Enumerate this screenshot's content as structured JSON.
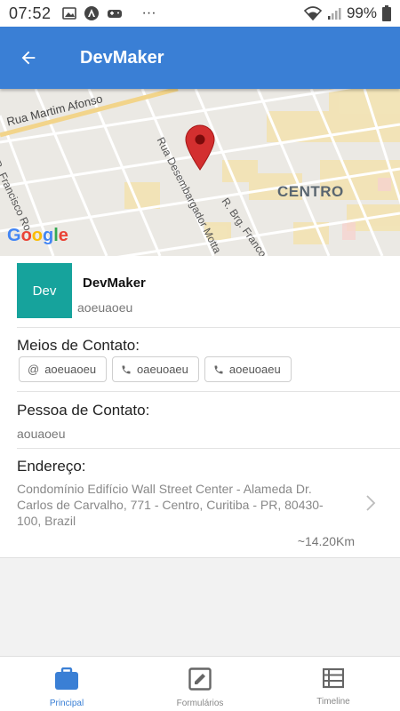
{
  "status_bar": {
    "time": "07:52",
    "battery": "99%",
    "more": "···"
  },
  "app_bar": {
    "title": "DevMaker"
  },
  "map": {
    "streets": [
      "Rua Martim Afonso",
      "R. Francisco Ro",
      "Rua Desembargador Motta",
      "R. Brg. Franco"
    ],
    "district": "CENTRO",
    "attribution": "Google"
  },
  "company": {
    "logo_text": "Dev",
    "name": "DevMaker",
    "subtitle": "aoeuaoeu"
  },
  "contact_means": {
    "title": "Meios de Contato:",
    "chips": [
      {
        "icon": "at-icon",
        "label": "aoeuaoeu"
      },
      {
        "icon": "phone-icon",
        "label": "oaeuoaeu"
      },
      {
        "icon": "phone-icon",
        "label": "aoeuoaeu"
      }
    ]
  },
  "contact_person": {
    "title": "Pessoa de Contato:",
    "value": "aouaoeu"
  },
  "address": {
    "title": "Endereço:",
    "value": "Condomínio Edifício Wall Street Center - Alameda Dr. Carlos de Carvalho, 771 - Centro, Curitiba - PR, 80430-100, Brazil",
    "distance": "~14.20Km"
  },
  "bottom_nav": {
    "items": [
      {
        "label": "Principal",
        "icon": "briefcase-icon",
        "active": true
      },
      {
        "label": "Formulários",
        "icon": "edit-icon",
        "active": false
      },
      {
        "label": "Timeline",
        "icon": "list-icon",
        "active": false
      }
    ]
  },
  "colors": {
    "primary": "#3a7fd5",
    "logo_bg": "#16a39c",
    "pin": "#d32f2f"
  }
}
